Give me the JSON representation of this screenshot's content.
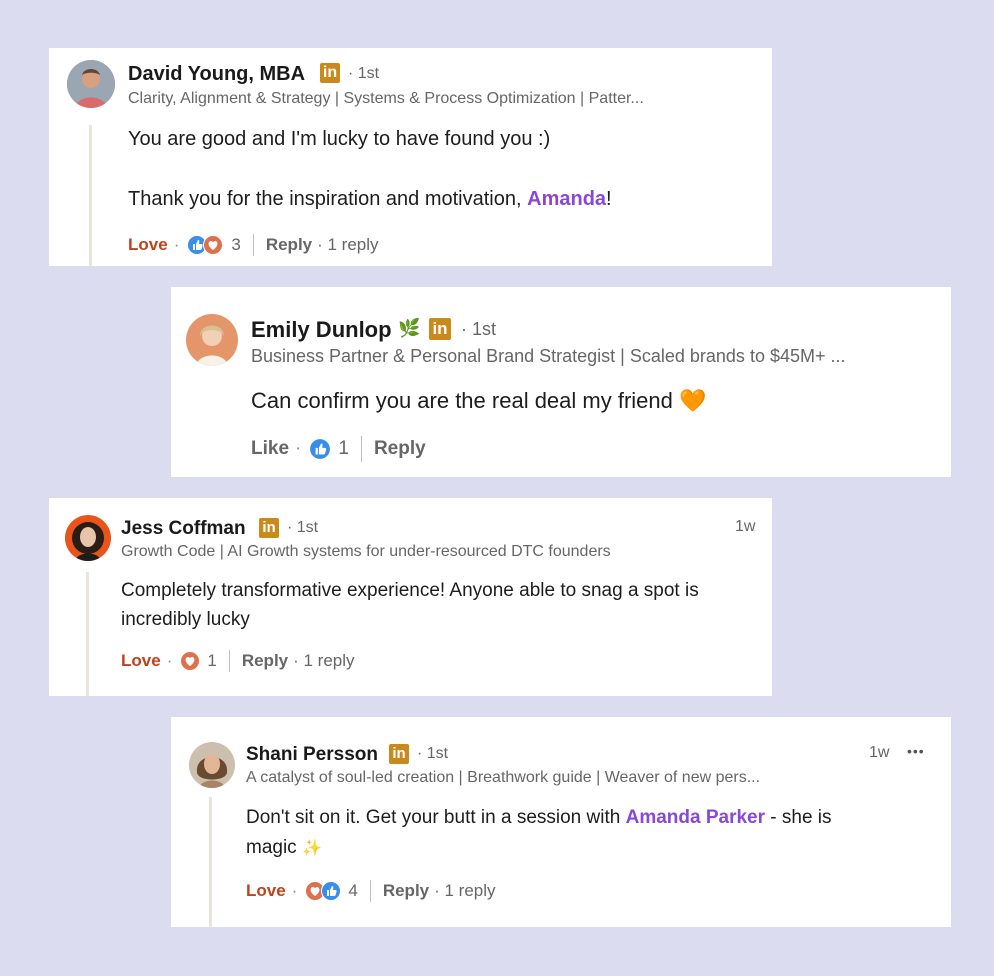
{
  "comments": [
    {
      "name": "David Young, MBA",
      "degree": "· 1st",
      "headline": "Clarity, Alignment & Strategy | Systems & Process Optimization | Patter...",
      "line1": "You are good and I'm lucky to have found you :)",
      "line2_pre": "Thank you for the inspiration and motivation, ",
      "line2_mention": "Amanda",
      "line2_post": "!",
      "reaction_action": "Love",
      "reaction_count": "3",
      "reply_label": "Reply",
      "replies": "· 1 reply"
    },
    {
      "name": "Emily Dunlop",
      "name_emoji": "🌿",
      "degree": "· 1st",
      "headline": "Business Partner & Personal Brand Strategist | Scaled brands to $45M+ ...",
      "line1": "Can confirm you are the real deal my friend",
      "line1_emoji": "🧡",
      "reaction_action": "Like",
      "reaction_count": "1",
      "reply_label": "Reply"
    },
    {
      "name": "Jess Coffman",
      "degree": "· 1st",
      "time": "1w",
      "headline": "Growth Code | AI Growth systems for under-resourced DTC founders",
      "line1": "Completely transformative experience! Anyone able to snag a spot is",
      "line2": "incredibly lucky",
      "reaction_action": "Love",
      "reaction_count": "1",
      "reply_label": "Reply",
      "replies": "· 1 reply"
    },
    {
      "name": "Shani Persson",
      "degree": "· 1st",
      "time": "1w",
      "more": "•••",
      "headline": "A catalyst of soul-led creation | Breathwork guide | Weaver of new pers...",
      "line1_pre": "Don't sit on it. Get your butt in a session with ",
      "line1_mention": "Amanda Parker",
      "line1_post": " - she is",
      "line2": "magic",
      "line2_emoji": "✨",
      "reaction_action": "Love",
      "reaction_count": "4",
      "reply_label": "Reply",
      "replies": "· 1 reply"
    }
  ],
  "li_badge": "in",
  "colors": {
    "background": "#dcdcf0",
    "mention": "#8847d9",
    "love": "#c1411c",
    "badge": "#c98a1b"
  },
  "icons": [
    "linkedin-badge-icon",
    "like-reaction-icon",
    "love-reaction-icon",
    "more-options-icon"
  ]
}
